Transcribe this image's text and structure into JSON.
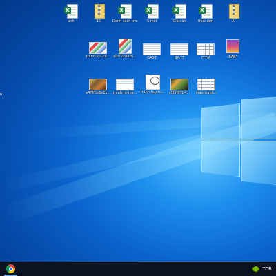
{
  "desktop": {
    "row1": [
      {
        "label": "ảnh",
        "type": "excel"
      },
      {
        "label": "15",
        "type": "zip"
      },
      {
        "label": "Danh sách trẻ 5 tuổi th...",
        "type": "excel"
      },
      {
        "label": "5 mới",
        "type": "excel"
      },
      {
        "label": "Giáo án",
        "type": "excel"
      },
      {
        "label": "thực đơn",
        "type": "excel"
      },
      {
        "label": "A",
        "type": "zip"
      }
    ],
    "row2": [
      {
        "label": "tranh-vui-ca...",
        "type": "thumb-colorful"
      },
      {
        "label": "a5f72c8ac6...",
        "type": "thumb-colorful"
      },
      {
        "label": "GAST",
        "type": "thumb-lines"
      },
      {
        "label": "GA.TT",
        "type": "thumb-lines"
      },
      {
        "label": "TTTM",
        "type": "thumb-table"
      },
      {
        "label": "BABT",
        "type": "thumb-stack"
      }
    ],
    "row3": [
      {
        "label": "a4f9f5b6c1b...",
        "type": "thumb-pic"
      },
      {
        "label": "tranh-to-ma...",
        "type": "thumb-lines"
      },
      {
        "label": "tranh-tap-to...",
        "type": "thumb-sketch"
      },
      {
        "label": "c50f8f7b4...",
        "type": "thumb-pic"
      },
      {
        "label": "mau-tranh...",
        "type": "thumb-table"
      }
    ],
    "edge_label": "n"
  },
  "taskbar": {
    "pinned": [
      {
        "name": "chrome",
        "icon": "chrome-icon"
      }
    ],
    "tray": {
      "nvidia_icon": "nvidia-icon",
      "language": "TCR"
    }
  }
}
